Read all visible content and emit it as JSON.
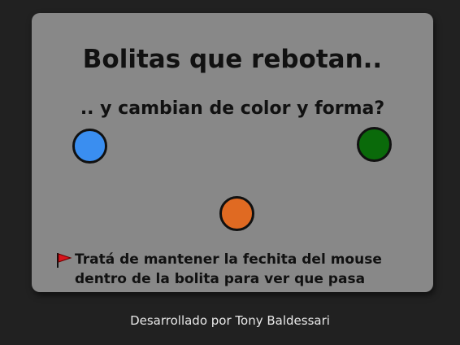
{
  "game": {
    "title": "Bolitas que rebotan..",
    "subtitle": ".. y cambian de color y forma?",
    "hint_line1": "Tratá de mantener la fechita del mouse",
    "hint_line2": "dentro de la bolita para ver que pasa",
    "hint_icon": "red-flag-icon",
    "balls": [
      {
        "name": "blue-ball",
        "color": "#3a8ef0"
      },
      {
        "name": "green-ball",
        "color": "#0a6a0a"
      },
      {
        "name": "orange-ball",
        "color": "#e06a22"
      }
    ],
    "stage_color": "#888888",
    "background_color": "#212121"
  },
  "footer": {
    "credit": "Desarrollado por Tony Baldessari"
  }
}
